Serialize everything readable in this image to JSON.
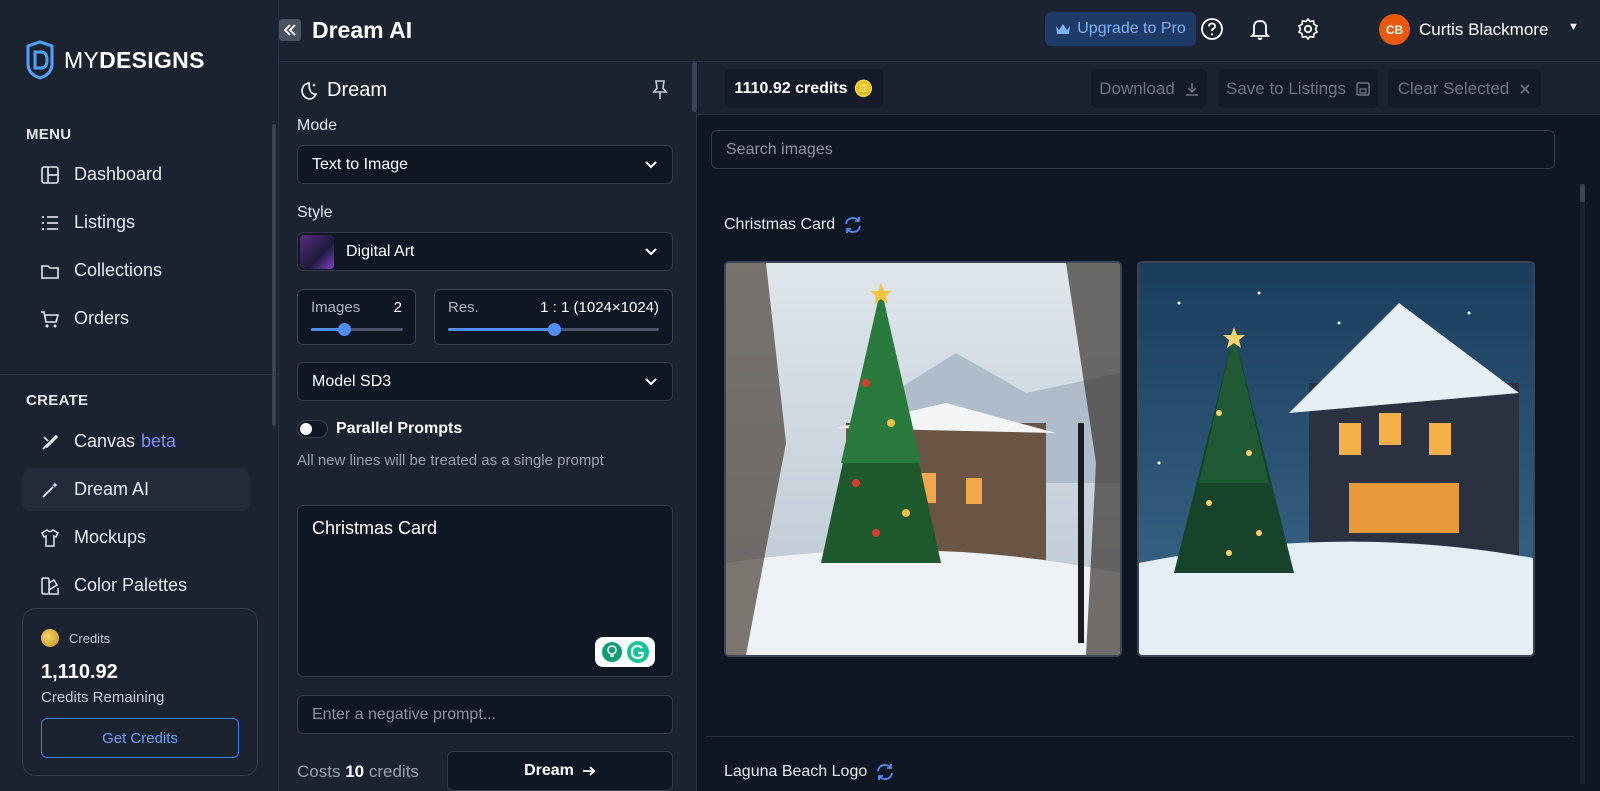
{
  "brand": {
    "prefix": "MY",
    "name": "DESIGNS"
  },
  "sidebar": {
    "menu_title": "MENU",
    "menu_items": [
      {
        "label": "Dashboard",
        "icon": "layout-icon"
      },
      {
        "label": "Listings",
        "icon": "list-icon"
      },
      {
        "label": "Collections",
        "icon": "folder-icon"
      },
      {
        "label": "Orders",
        "icon": "cart-icon"
      }
    ],
    "create_title": "CREATE",
    "create_items": [
      {
        "label": "Canvas",
        "badge": "beta",
        "icon": "brush-icon"
      },
      {
        "label": "Dream AI",
        "icon": "magic-wand-icon",
        "active": true
      },
      {
        "label": "Mockups",
        "icon": "shirt-icon"
      },
      {
        "label": "Color Palettes",
        "icon": "palette-icon"
      }
    ],
    "credits_card": {
      "label": "Credits",
      "amount": "1,110.92",
      "sub": "Credits Remaining",
      "button": "Get Credits"
    }
  },
  "header": {
    "title": "Dream AI",
    "upgrade_label": "Upgrade to Pro",
    "user_initials": "CB",
    "user_name": "Curtis Blackmore"
  },
  "panel": {
    "title": "Dream",
    "mode_label": "Mode",
    "mode_value": "Text to Image",
    "style_label": "Style",
    "style_value": "Digital Art",
    "images_label": "Images",
    "images_value": "2",
    "images_fraction": 0.36,
    "res_label": "Res.",
    "res_value": "1 : 1 (1024×1024)",
    "res_fraction": 0.5,
    "model_value": "Model SD3",
    "parallel_label": "Parallel Prompts",
    "parallel_on": false,
    "helper": "All new lines will be treated as a single prompt",
    "prompt_value": "Christmas Card",
    "negative_placeholder": "Enter a negative prompt...",
    "cost_prefix": "Costs",
    "cost_amount": "10",
    "cost_suffix": "credits",
    "dream_button": "Dream"
  },
  "main": {
    "credits_pill": "1110.92 credits",
    "download_label": "Download",
    "save_label": "Save to Listings",
    "clear_label": "Clear Selected",
    "search_placeholder": "Search images",
    "groups": [
      {
        "title": "Christmas Card"
      },
      {
        "title": "Laguna Beach Logo"
      }
    ]
  },
  "colors": {
    "accent": "#4f8ef7",
    "avatar": "#ea580c",
    "upgrade_bg": "#1e3a66"
  }
}
